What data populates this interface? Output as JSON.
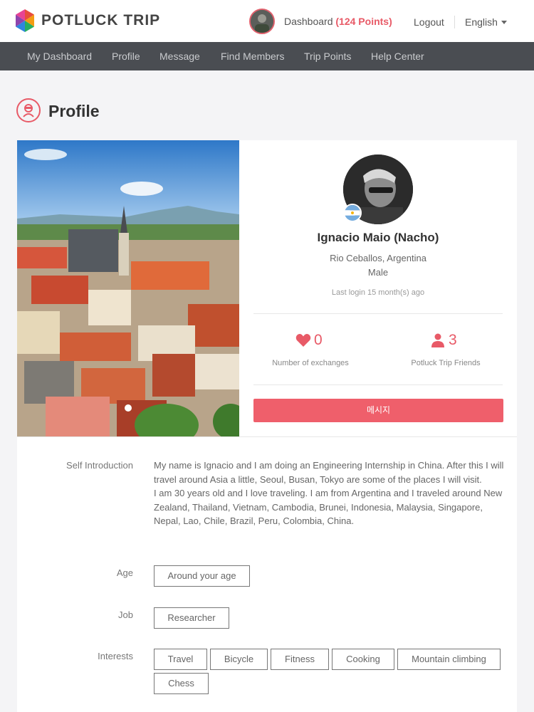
{
  "header": {
    "logo_text": "POTLUCK TRIP",
    "dashboard_label": "Dashboard",
    "points_label": "(124 Points)",
    "logout_label": "Logout",
    "language_label": "English"
  },
  "nav": {
    "items": [
      {
        "label": "My Dashboard"
      },
      {
        "label": "Profile"
      },
      {
        "label": "Message"
      },
      {
        "label": "Find Members"
      },
      {
        "label": "Trip Points"
      },
      {
        "label": "Help Center"
      }
    ]
  },
  "page": {
    "title": "Profile"
  },
  "profile": {
    "name": "Ignacio Maio (Nacho)",
    "location": "Rio Ceballos, Argentina",
    "gender": "Male",
    "last_login": "Last login 15 month(s) ago",
    "stats": {
      "exchanges_value": "0",
      "exchanges_label": "Number of exchanges",
      "friends_value": "3",
      "friends_label": "Potluck Trip Friends"
    },
    "message_button": "메시지"
  },
  "details": {
    "self_intro_label": "Self Introduction",
    "self_intro_p1": "My name is Ignacio and I am doing an Engineering Internship in China. After this I will travel around Asia a little, Seoul, Busan, Tokyo are some of the places I will visit.",
    "self_intro_p2": "I am 30 years old and I love traveling. I am from Argentina and I traveled around New Zealand, Thailand, Vietnam, Cambodia, Brunei, Indonesia, Malaysia, Singapore, Nepal, Lao, Chile, Brazil, Peru, Colombia, China.",
    "age_label": "Age",
    "age_value": "Around your age",
    "job_label": "Job",
    "job_value": "Researcher",
    "interests_label": "Interests",
    "interests": [
      "Travel",
      "Bicycle",
      "Fitness",
      "Cooking",
      "Mountain climbing",
      "Chess"
    ]
  },
  "colors": {
    "accent": "#e85a67",
    "nav_bg": "#4a4d52"
  }
}
